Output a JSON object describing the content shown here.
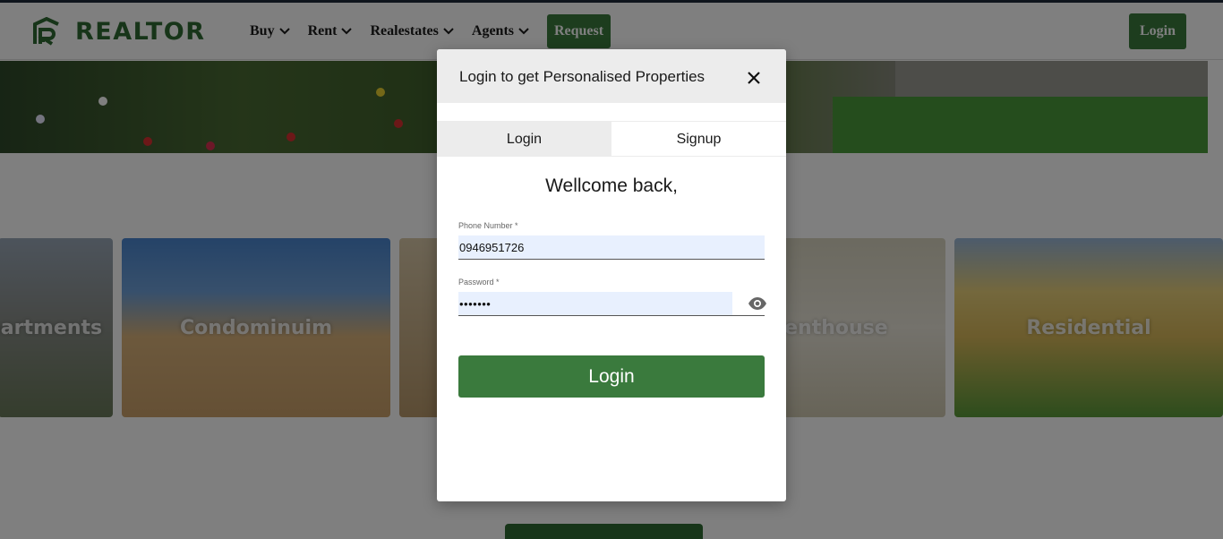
{
  "brand": {
    "name": "REALTOR",
    "icon": "home-r-logo-icon",
    "color": "#2f6b32"
  },
  "nav": {
    "items": [
      {
        "label": "Buy",
        "icon": "chevron-down-icon"
      },
      {
        "label": "Rent",
        "icon": "chevron-down-icon"
      },
      {
        "label": "Realestates",
        "icon": "chevron-down-icon"
      },
      {
        "label": "Agents",
        "icon": "chevron-down-icon"
      }
    ],
    "request_label": "Request",
    "login_label": "Login"
  },
  "categories": [
    {
      "label": "Apartments"
    },
    {
      "label": "Condominuim"
    },
    {
      "label": ""
    },
    {
      "label": "Penthouse"
    },
    {
      "label": "Residential"
    }
  ],
  "modal": {
    "title": "Login to get Personalised Properties",
    "close_icon": "close-icon",
    "tabs": [
      {
        "label": "Login",
        "active": true
      },
      {
        "label": "Signup",
        "active": false
      }
    ],
    "welcome": "Wellcome back,",
    "phone": {
      "label": "Phone Number *",
      "value": "0946951726"
    },
    "password": {
      "label": "Password *",
      "value": "•••••••",
      "icon": "eye-icon"
    },
    "submit_label": "Login"
  },
  "colors": {
    "accent": "#3a7a3d",
    "input_bg": "#e8f0fe",
    "header_bg": "#ececec"
  }
}
